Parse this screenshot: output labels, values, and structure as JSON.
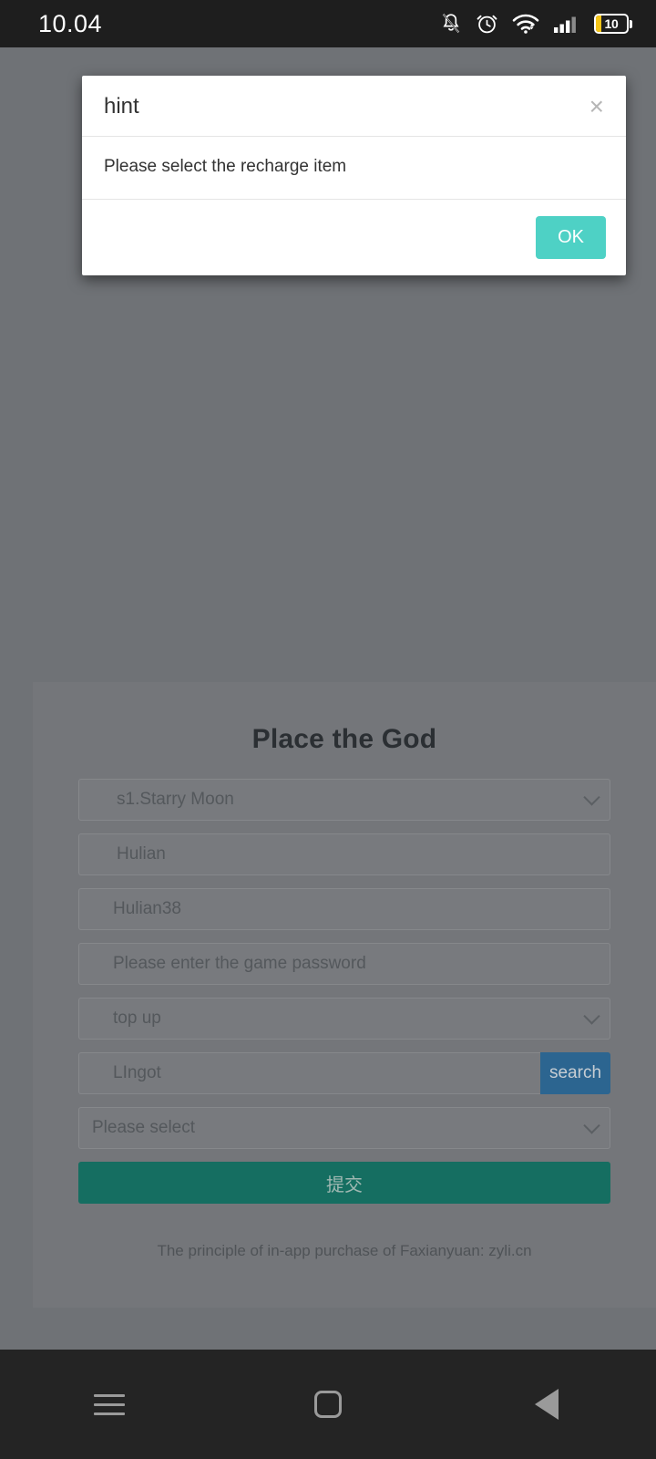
{
  "statusbar": {
    "time": "10.04",
    "icons": [
      "notifications-off-icon",
      "alarm-icon",
      "wifi-icon",
      "signal-icon",
      "battery-icon"
    ],
    "battery_level": "10"
  },
  "dialog": {
    "title": "hint",
    "close_label": "×",
    "message": "Please select the recharge item",
    "ok_label": "OK",
    "ok_color": "#4ed1c5"
  },
  "form": {
    "title": "Place the God",
    "server_select": {
      "value": "s1.Starry Moon",
      "icon": "chevron-down-icon"
    },
    "account_field": {
      "value": "Hulian"
    },
    "role_field": {
      "value": "Hulian38"
    },
    "password_field": {
      "placeholder": "Please enter the game password"
    },
    "type_select": {
      "value": "top up",
      "icon": "chevron-down-icon"
    },
    "search": {
      "value": "LIngot",
      "button_label": "search",
      "button_color": "#2c6590"
    },
    "item_select": {
      "value": "Please select",
      "icon": "chevron-down-icon"
    },
    "submit_label": "提交",
    "submit_color": "#156e61",
    "footer_text": "The principle of in-app purchase of Faxianyuan: zyli.cn"
  },
  "navbar": {
    "recents": "menu-icon",
    "home": "home-square-icon",
    "back": "back-triangle-icon"
  }
}
